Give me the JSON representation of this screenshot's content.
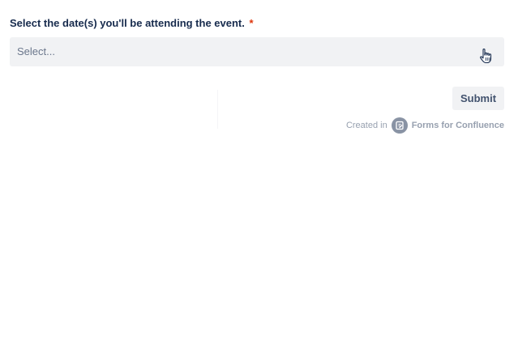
{
  "form": {
    "field_label": "Select the date(s) you'll be attending the event.",
    "required_marker": "*",
    "select_placeholder": "Select...",
    "submit_label": "Submit"
  },
  "footer": {
    "created_in": "Created in",
    "brand_name": "Forms for Confluence",
    "brand_icon": "forms-logo-icon"
  },
  "colors": {
    "required": "#de350b",
    "select_background": "#f1f2f4",
    "muted_text": "#97a0af"
  }
}
